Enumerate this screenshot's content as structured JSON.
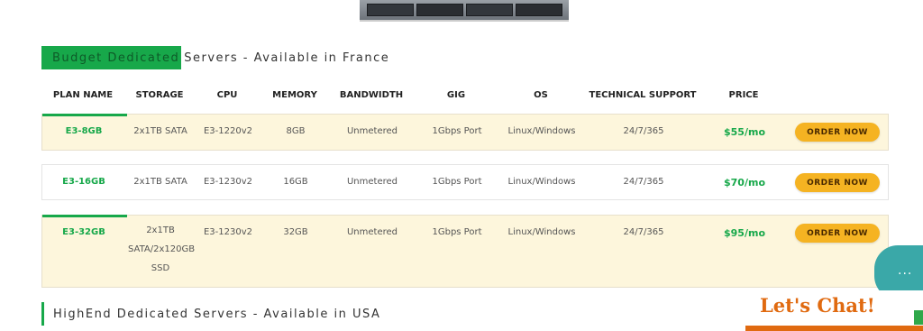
{
  "section1": {
    "title_highlight": "Budget Dedicated",
    "title_rest": "Servers - Available in France"
  },
  "table": {
    "headers": [
      "PLAN NAME",
      "STORAGE",
      "CPU",
      "MEMORY",
      "BANDWIDTH",
      "GIG",
      "OS",
      "TECHNICAL SUPPORT",
      "PRICE"
    ],
    "rows": [
      {
        "plan": "E3-8GB",
        "storage": "2x1TB SATA",
        "cpu": "E3-1220v2",
        "memory": "8GB",
        "bandwidth": "Unmetered",
        "gig": "1Gbps Port",
        "os": "Linux/Windows",
        "support": "24/7/365",
        "price": "$55/mo",
        "button": "ORDER NOW"
      },
      {
        "plan": "E3-16GB",
        "storage": "2x1TB SATA",
        "cpu": "E3-1230v2",
        "memory": "16GB",
        "bandwidth": "Unmetered",
        "gig": "1Gbps Port",
        "os": "Linux/Windows",
        "support": "24/7/365",
        "price": "$70/mo",
        "button": "ORDER NOW"
      },
      {
        "plan": "E3-32GB",
        "storage": "2x1TB SATA/2x120GB SSD",
        "cpu": "E3-1230v2",
        "memory": "32GB",
        "bandwidth": "Unmetered",
        "gig": "1Gbps Port",
        "os": "Linux/Windows",
        "support": "24/7/365",
        "price": "$95/mo",
        "button": "ORDER NOW"
      }
    ]
  },
  "section2": {
    "title": "HighEnd Dedicated Servers - Available in USA"
  },
  "chat": {
    "label": "Let's Chat!",
    "dots": "..."
  },
  "colors": {
    "accent_green": "#17a84a",
    "row_yellow": "#fdf6dc",
    "button_orange": "#f5b322",
    "chat_orange": "#e06a10"
  }
}
